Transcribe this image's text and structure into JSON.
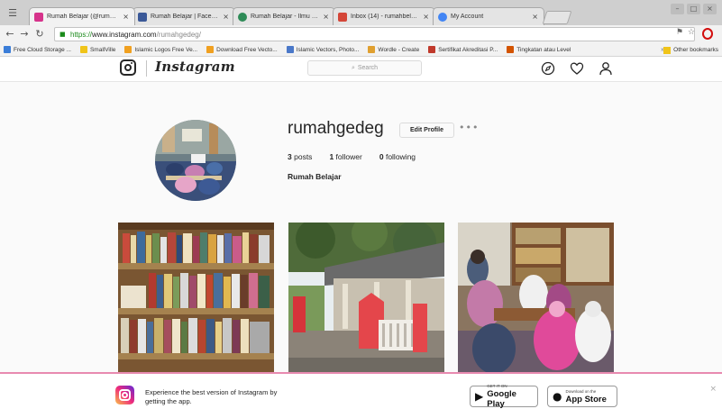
{
  "browser": {
    "tabs": [
      {
        "title": "Rumah Belajar (@rumah...",
        "favicon_color": "#d6338b",
        "active": true
      },
      {
        "title": "Rumah Belajar | Facebo...",
        "favicon_color": "#3b5998",
        "active": false
      },
      {
        "title": "Rumah Belajar - Ilmu Pe...",
        "favicon_color": "#2e8b57",
        "active": false
      },
      {
        "title": "Inbox (14) - rumahbelaja...",
        "favicon_color": "#d44638",
        "active": false
      },
      {
        "title": "My Account",
        "favicon_color": "#4285f4",
        "active": false
      }
    ],
    "tab_close": "×",
    "url": {
      "protocol": "https://",
      "host": "www.instagram.com",
      "path": "/rumahgedeg/"
    },
    "bookmarks": [
      {
        "label": "Free Cloud Storage ...",
        "color": "#3b7dd8"
      },
      {
        "label": "SmallVille",
        "color": "#f0c419"
      },
      {
        "label": "Islamic Logos Free Ve...",
        "color": "#f0a020"
      },
      {
        "label": "Download Free Vecto...",
        "color": "#f0a020"
      },
      {
        "label": "Islamic Vectors, Photo...",
        "color": "#4a78c9"
      },
      {
        "label": "Wordle - Create",
        "color": "#e0a030"
      },
      {
        "label": "Sertifikat Akreditasi P...",
        "color": "#c0392b"
      },
      {
        "label": "Tingkatan atau Level",
        "color": "#d35400"
      }
    ],
    "bookmarks_more": "»",
    "other_bookmarks": "Other bookmarks"
  },
  "instagram": {
    "brand": "Instagram",
    "search_placeholder": "Search",
    "profile": {
      "username": "rumahgedeg",
      "edit_label": "Edit Profile",
      "more_label": "•••",
      "posts_count": "3",
      "posts_label": "posts",
      "followers_count": "1",
      "followers_label": "follower",
      "following_count": "0",
      "following_label": "following",
      "full_name": "Rumah Belajar"
    },
    "banner": {
      "text": "Experience the best version of Instagram by getting the app.",
      "google_small": "GET IT ON",
      "google_big": "Google Play",
      "apple_small": "Download on the",
      "apple_big": "App Store",
      "close": "×"
    }
  },
  "colors": {
    "accent_pink": "#e88ab0",
    "ig_text": "#262626"
  }
}
